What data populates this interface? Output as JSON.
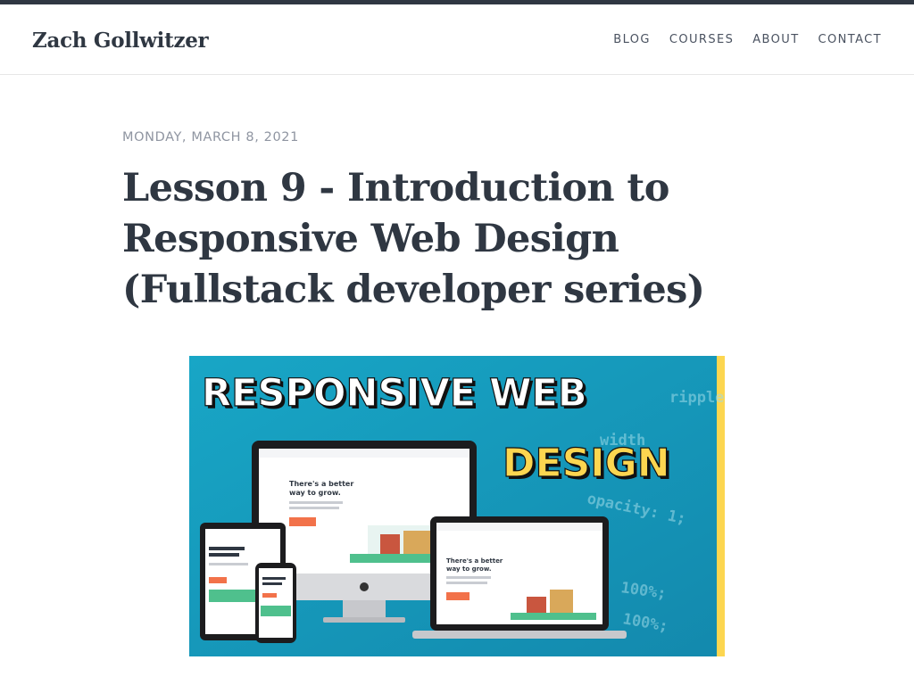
{
  "site": {
    "brand": "Zach Gollwitzer",
    "nav": [
      {
        "label": "BLOG"
      },
      {
        "label": "COURSES"
      },
      {
        "label": "ABOUT"
      },
      {
        "label": "CONTACT"
      }
    ]
  },
  "post": {
    "date": "MONDAY, MARCH 8, 2021",
    "title": "Lesson 9 - Introduction to Responsive Web Design (Fullstack developer series)"
  },
  "hero_image": {
    "headline_line1": "RESPONSIVE WEB",
    "headline_line2": "DESIGN",
    "code_words": [
      "ripple",
      "width",
      "opacity: 1;",
      "100%;",
      "100%;"
    ],
    "mockup_heading_line1": "There's a better",
    "mockup_heading_line2": "way to grow.",
    "colors": {
      "background": "#1a9fc2",
      "headline_text": "#ffffff",
      "design_text": "#fcd650",
      "accent": "#f2724a",
      "right_edge": "#fcd650"
    }
  }
}
